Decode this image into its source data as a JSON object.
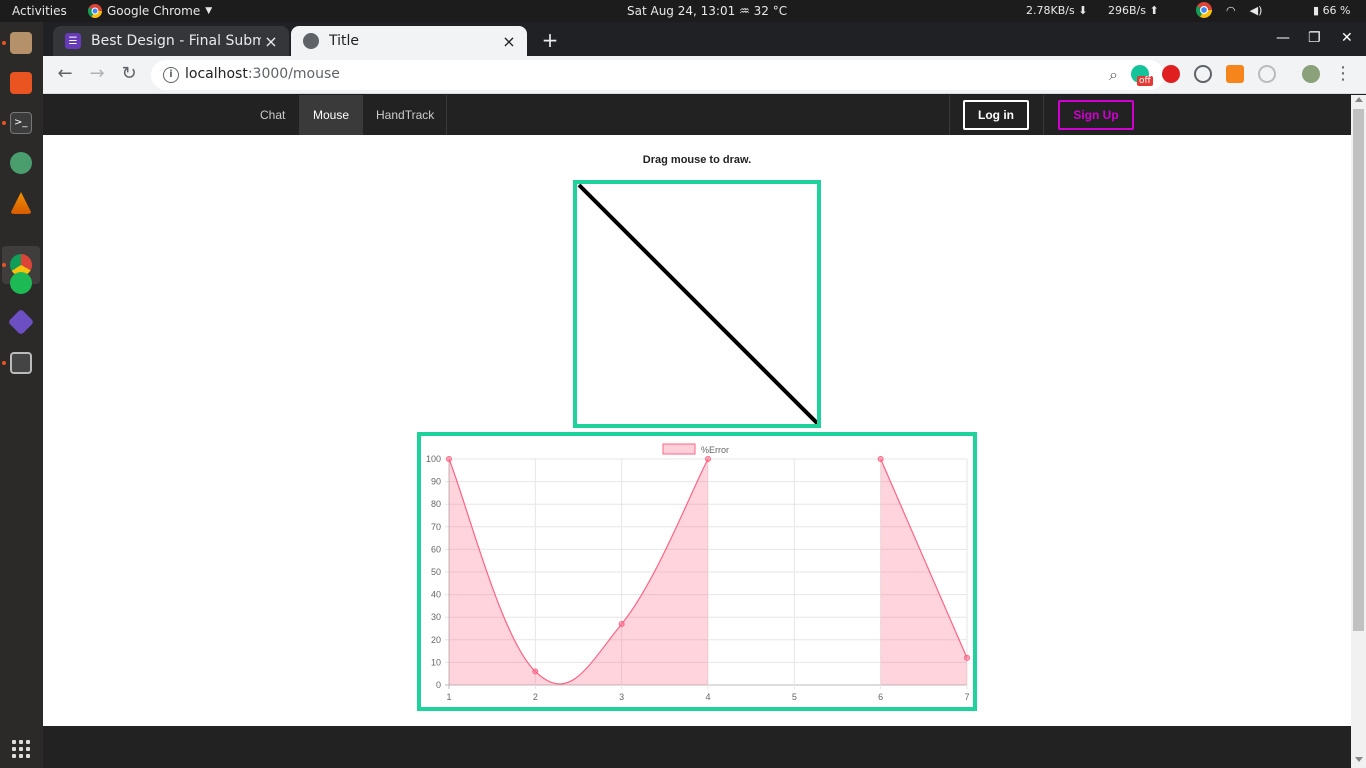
{
  "system": {
    "activities": "Activities",
    "app_name": "Google Chrome",
    "clock": "Sat Aug 24, 13:01",
    "weather": "32 °C",
    "net_down": "2.78KB/s",
    "net_up": "296B/s",
    "battery": "66 %"
  },
  "browser": {
    "tabs": [
      {
        "title": "Best Design - Final Submis",
        "close": "×"
      },
      {
        "title": "Title",
        "close": "×"
      }
    ],
    "new_tab": "+",
    "url_host": "localhost",
    "url_path": ":3000/mouse",
    "extension_badge": "off"
  },
  "site": {
    "nav": [
      "Chat",
      "Mouse",
      "HandTrack"
    ],
    "active_nav": "Mouse",
    "login": "Log in",
    "signup": "Sign Up",
    "instruction": "Drag mouse to draw.",
    "accent_color": "#1fd19b",
    "signup_color": "#d100d1"
  },
  "chart_data": {
    "type": "area",
    "x": [
      1,
      2,
      3,
      4,
      5,
      6,
      7
    ],
    "series": [
      {
        "name": "%Error",
        "values": [
          100,
          6,
          27,
          100,
          null,
          100,
          12
        ],
        "color": "#ff6384"
      }
    ],
    "ylim": [
      0,
      100
    ],
    "yticks": [
      0,
      10,
      20,
      30,
      40,
      50,
      60,
      70,
      80,
      90,
      100
    ],
    "legend": "top-center",
    "grid": true
  }
}
